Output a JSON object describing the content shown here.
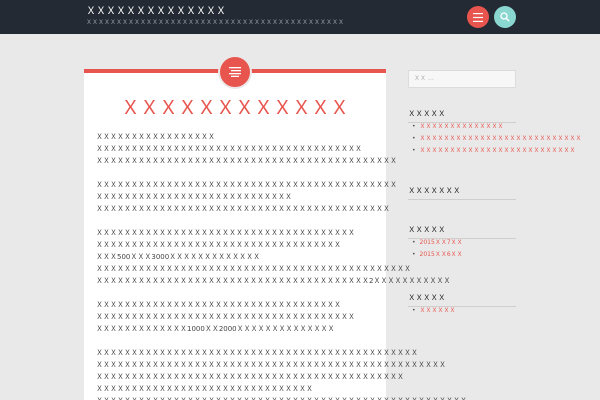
{
  "header": {
    "site_title": "ＸＸＸＸＸＸＸＸＸＸＸＸＸＸ",
    "site_description": "ＸＸＸＸＸＸＸＸＸＸＸＸＸＸＸＸＸＸＸＸＸＸＸＸＸＸＸＸＸＸＸＸＸＸＸＸＸＸＸＸＸＸＸ",
    "menu_icon": "menu-icon",
    "search_icon": "search-icon",
    "colors": {
      "bar": "#232a34",
      "accent": "#e8554e",
      "search": "#8ad6d0"
    }
  },
  "post": {
    "format_icon": "text-lines-icon",
    "title": "ＸＸＸＸＸＸＸＸＸＸＸＸ",
    "paragraphs": [
      [
        "ＸＸＸＸＸＸＸＸＸＸＸＸＸＸＸＸＸ",
        "ＸＸＸＸＸＸＸＸＸＸＸＸＸＸＸＸＸＸＸＸＸＸＸＸＸＸＸＸＸＸＸＸＸＸＸＸＸＸ",
        "ＸＸＸＸＸＸＸＸＸＸＸＸＸＸＸＸＸＸＸＸＸＸＸＸＸＸＸＸＸＸＸＸＸＸＸＸＸＸＸＸＸＸＸ"
      ],
      [
        "ＸＸＸＸＸＸＸＸＸＸＸＸＸＸＸＸＸＸＸＸＸＸＸＸＸＸＸＸＸＸＸＸＸＸＸＸＸＸＸＸＸＸＸ",
        "ＸＸＸＸＸＸＸＸＸＸＸＸＸＸＸＸＸＸＸＸＸＸＸＸＸＸＸＸ",
        "ＸＸＸＸＸＸＸＸＸＸＸＸＸＸＸＸＸＸＸＸＸＸＸＸＸＸＸＸＸＸＸＸＸＸＸＸＸＸＸＸＸＸ"
      ],
      [
        "ＸＸＸＸＸＸＸＸＸＸＸＸＸＸＸＸＸＸＸＸＸＸＸＸＸＸＸＸＸＸＸＸＸＸＸＸＸ",
        "ＸＸＸＸＸＸＸＸＸＸＸＸＸＸＸＸＸＸＸＸＸＸＸＸＸＸＸＸＸＸＸＸＸＸＸ",
        "ＸＸＸ500ＸＸＸ3000ＸＸＸＸＸＸＸＸＸＸＸＸＸ",
        "ＸＸＸＸＸＸＸＸＸＸＸＸＸＸＸＸＸＸＸＸＸＸＸＸＸＸＸＸＸＸＸＸＸＸＸＸＸＸＸＸＸＸＸＸＸ",
        "ＸＸＸＸＸＸＸＸＸＸＸＸＸＸＸＸＸＸＸＸＸＸＸＸＸＸＸＸＸＸＸＸＸＸＸＸＸＸＸ2ＸＸＸＸＸＸＸＸＸＸＸ"
      ],
      [
        "ＸＸＸＸＸＸＸＸＸＸＸＸＸＸＸＸＸＸＸＸＸＸＸＸＸＸＸＸＸＸＸＸＸＸＸ",
        "ＸＸＸＸＸＸＸＸＸＸＸＸＸＸＸＸＸＸＸＸＸＸＸＸＸＸＸＸＸＸＸＸＸＸＸＸＸ",
        "ＸＸＸＸＸＸＸＸＸＸＸＸＸ1000ＸＸ2000ＸＸＸＸＸＸＸＸＸＸＸＸＸＸ"
      ],
      [
        "ＸＸＸＸＸＸＸＸＸＸＸＸＸＸＸＸＸＸＸＸＸＸＸＸＸＸＸＸＸＸＸＸＸＸＸＸＸＸＸＸＸＸＸＸＸＸ",
        "ＸＸＸＸＸＸＸＸＸＸＸＸＸＸＸＸＸＸＸＸＸＸＸＸＸＸＸＸＸＸＸＸＸＸＸＸＸＸＸＸＸＸＸＸＸＸＸＸＸＸ",
        "ＸＸＸＸＸＸＸＸＸＸＸＸＸＸＸＸＸＸＸＸＸＸＸＸＸＸＸＸＸＸＸＸＸＸＸＸＸＸＸＸＸＸＸＸ",
        "ＸＸＸＸＸＸＸＸＸＸＸＸＸＸＸＸＸＸＸＸＸＸＸＸＸＸＸＸＸＸＸ",
        "ＸＸＸＸＸＸＸＸＸＸＸＸＸＸＸＸＸＸＸＸＸＸＸＸＸＸＸＸＸＸＸＸＸＸＸＸＸＸＸＸＸＸＸＸＸＸＸＸＸＸＸＸＸ"
      ]
    ]
  },
  "sidebar": {
    "search_placeholder": "ＸＸ …",
    "widgets": [
      {
        "title": "ＸＸＸＸＸ",
        "items": [
          "ＸＸＸＸＸＸＸＸＸＸＸＸＸＸ",
          "ＸＸＸＸＸＸＸＸＸＸＸＸＸＸＸＸＸＸＸＸＸＸＸＸＸＸＸ",
          "ＸＸＸＸＸＸＸＸＸＸＸＸＸＸＸＸＸＸＸＸＸＸＸＸＸＸ"
        ]
      },
      {
        "title": "ＸＸＸＸＸＸＸ",
        "items": []
      },
      {
        "title": "ＸＸＸＸＸ",
        "items": [
          "2015ＸＸ7ＸＸ",
          "2015ＸＸ6ＸＸ"
        ]
      },
      {
        "title": "ＸＸＸＸＸ",
        "items": [
          "ＸＸＸＸＸＸ"
        ]
      }
    ]
  }
}
